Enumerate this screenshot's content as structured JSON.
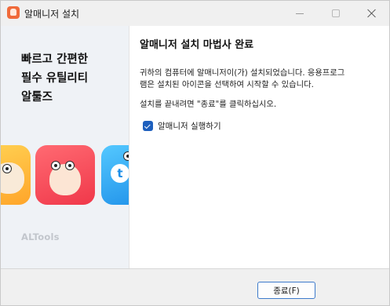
{
  "window": {
    "title": "알매니저 설치",
    "controls": {
      "minimize": "minimize-icon",
      "maximize": "maximize-icon",
      "close": "close-icon"
    }
  },
  "left_panel": {
    "slogan_lines": [
      "빠르고 간편한",
      "필수 유틸리티",
      "알툴즈"
    ],
    "brand": "ALTools",
    "app_cards": [
      "yellow-mascot-card",
      "red-mascot-card",
      "blue-mascot-card"
    ]
  },
  "main": {
    "heading": "알매니저 설치 마법사 완료",
    "description_lines": [
      "귀하의 컴퓨터에 알매니저이(가) 설치되었습니다. 응용프로그",
      "램은 설치된 아이콘을 선택하여 시작할 수 있습니다."
    ],
    "hint": "설치를 끝내려면 \"종료\"를 클릭하십시오.",
    "launch_checkbox": {
      "label": "알매니저 실행하기",
      "checked": true
    }
  },
  "footer": {
    "finish_button": "종료(F)"
  },
  "colors": {
    "accent": "#1d5fbd",
    "card_yellow": "#ffb52e",
    "card_red": "#f04a58",
    "card_blue": "#2b9ef0"
  }
}
